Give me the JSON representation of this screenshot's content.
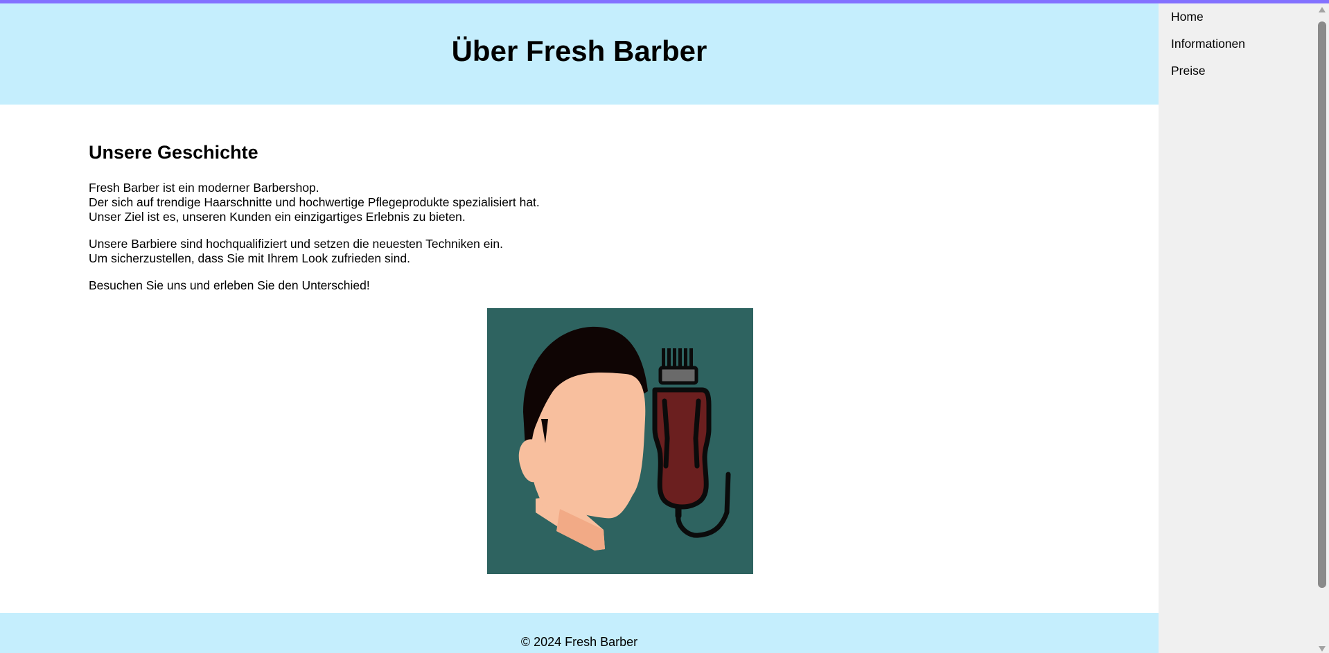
{
  "header": {
    "title": "Über Fresh Barber"
  },
  "section": {
    "heading": "Unsere Geschichte",
    "paragraphs": [
      [
        "Fresh Barber ist ein moderner Barbershop.",
        "Der sich auf trendige Haarschnitte und hochwertige Pflegeprodukte spezialisiert hat.",
        "Unser Ziel ist es, unseren Kunden ein einzigartiges Erlebnis zu bieten."
      ],
      [
        "Unsere Barbiere sind hochqualifiziert und setzen die neuesten Techniken ein.",
        "Um sicherzustellen, dass Sie mit Ihrem Look zufrieden sind."
      ],
      [
        "Besuchen Sie uns und erleben Sie den Unterschied!"
      ]
    ]
  },
  "footer": {
    "text": "© 2024 Fresh Barber"
  },
  "nav": {
    "items": [
      "Home",
      "Informationen",
      "Preise"
    ]
  },
  "colors": {
    "header_bg": "#c5eefd",
    "top_accent": "#8371ff",
    "sidebar_bg": "#f0f0f0",
    "illustration_bg": "#2e6360",
    "skin": "#f8bf9e",
    "hair": "#0f0504",
    "clipper": "#6b1f1f"
  }
}
